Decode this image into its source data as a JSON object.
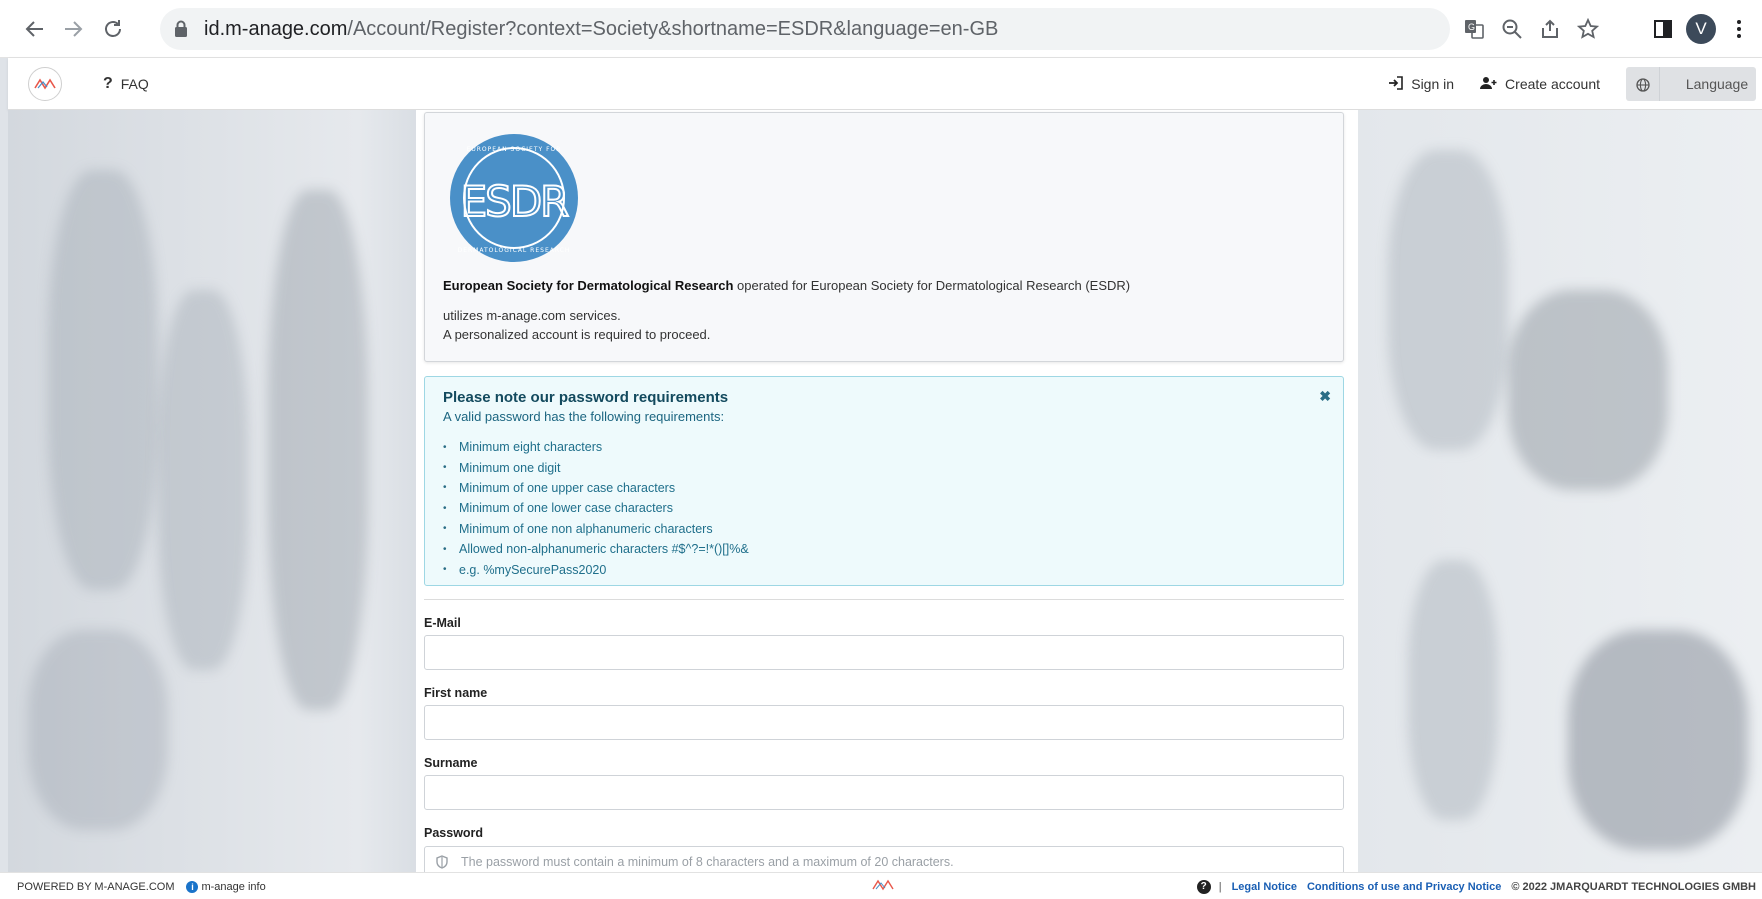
{
  "browser": {
    "url_host": "id.m-anage.com",
    "url_path": "/Account/Register?context=Society&shortname=ESDR&language=en-GB",
    "profile_initial": "V",
    "icons": [
      "back-icon",
      "forward-icon",
      "reload-icon",
      "lock-icon",
      "translate-icon",
      "zoom-icon",
      "share-icon",
      "star-icon",
      "sidepanel-icon",
      "more-icon"
    ]
  },
  "header": {
    "faq_label": "FAQ",
    "sign_in_label": "Sign in",
    "create_account_label": "Create account",
    "language_label": "Language"
  },
  "society": {
    "name": "European Society for Dermatological Research",
    "operated_for": " operated for European Society for Dermatological Research (ESDR)",
    "utilizes": "utilizes m-anage.com services.",
    "account_required": "A personalized account is required to proceed.",
    "logo_letters": "ESDR",
    "logo_ring_text": "EUROPEAN SOCIETY FOR DERMATOLOGICAL RESEARCH"
  },
  "notice": {
    "title": "Please note our password requirements",
    "subtitle": "A valid password has the following requirements:",
    "close_symbol": "✖",
    "items": [
      "Minimum eight characters",
      "Minimum one digit",
      "Minimum of one upper case characters",
      "Minimum of one lower case characters",
      "Minimum of one non alphanumeric characters",
      "Allowed non-alphanumeric characters #$^?=!*()[]%&",
      "e.g. %mySecurePass2020"
    ]
  },
  "form": {
    "email_label": "E-Mail",
    "email_value": "",
    "first_name_label": "First name",
    "first_name_value": "",
    "surname_label": "Surname",
    "surname_value": "",
    "password_label": "Password",
    "password_hint": "The password must contain a minimum of 8 characters and a maximum of 20 characters."
  },
  "footer": {
    "powered_by": "POWERED BY M-ANAGE.COM",
    "info_link": "m-anage info",
    "separator": "|",
    "legal_notice": "Legal Notice",
    "conditions": "Conditions of use and Privacy Notice",
    "copyright": "© 2022 JMARQUARDT TECHNOLOGIES GMBH"
  },
  "colors": {
    "brand_accent": "#e8574a",
    "logo_blue": "#4a90c8",
    "notice_bg": "#eefafc",
    "notice_border": "#9ed7e4",
    "link_blue": "#1a5fb4"
  }
}
